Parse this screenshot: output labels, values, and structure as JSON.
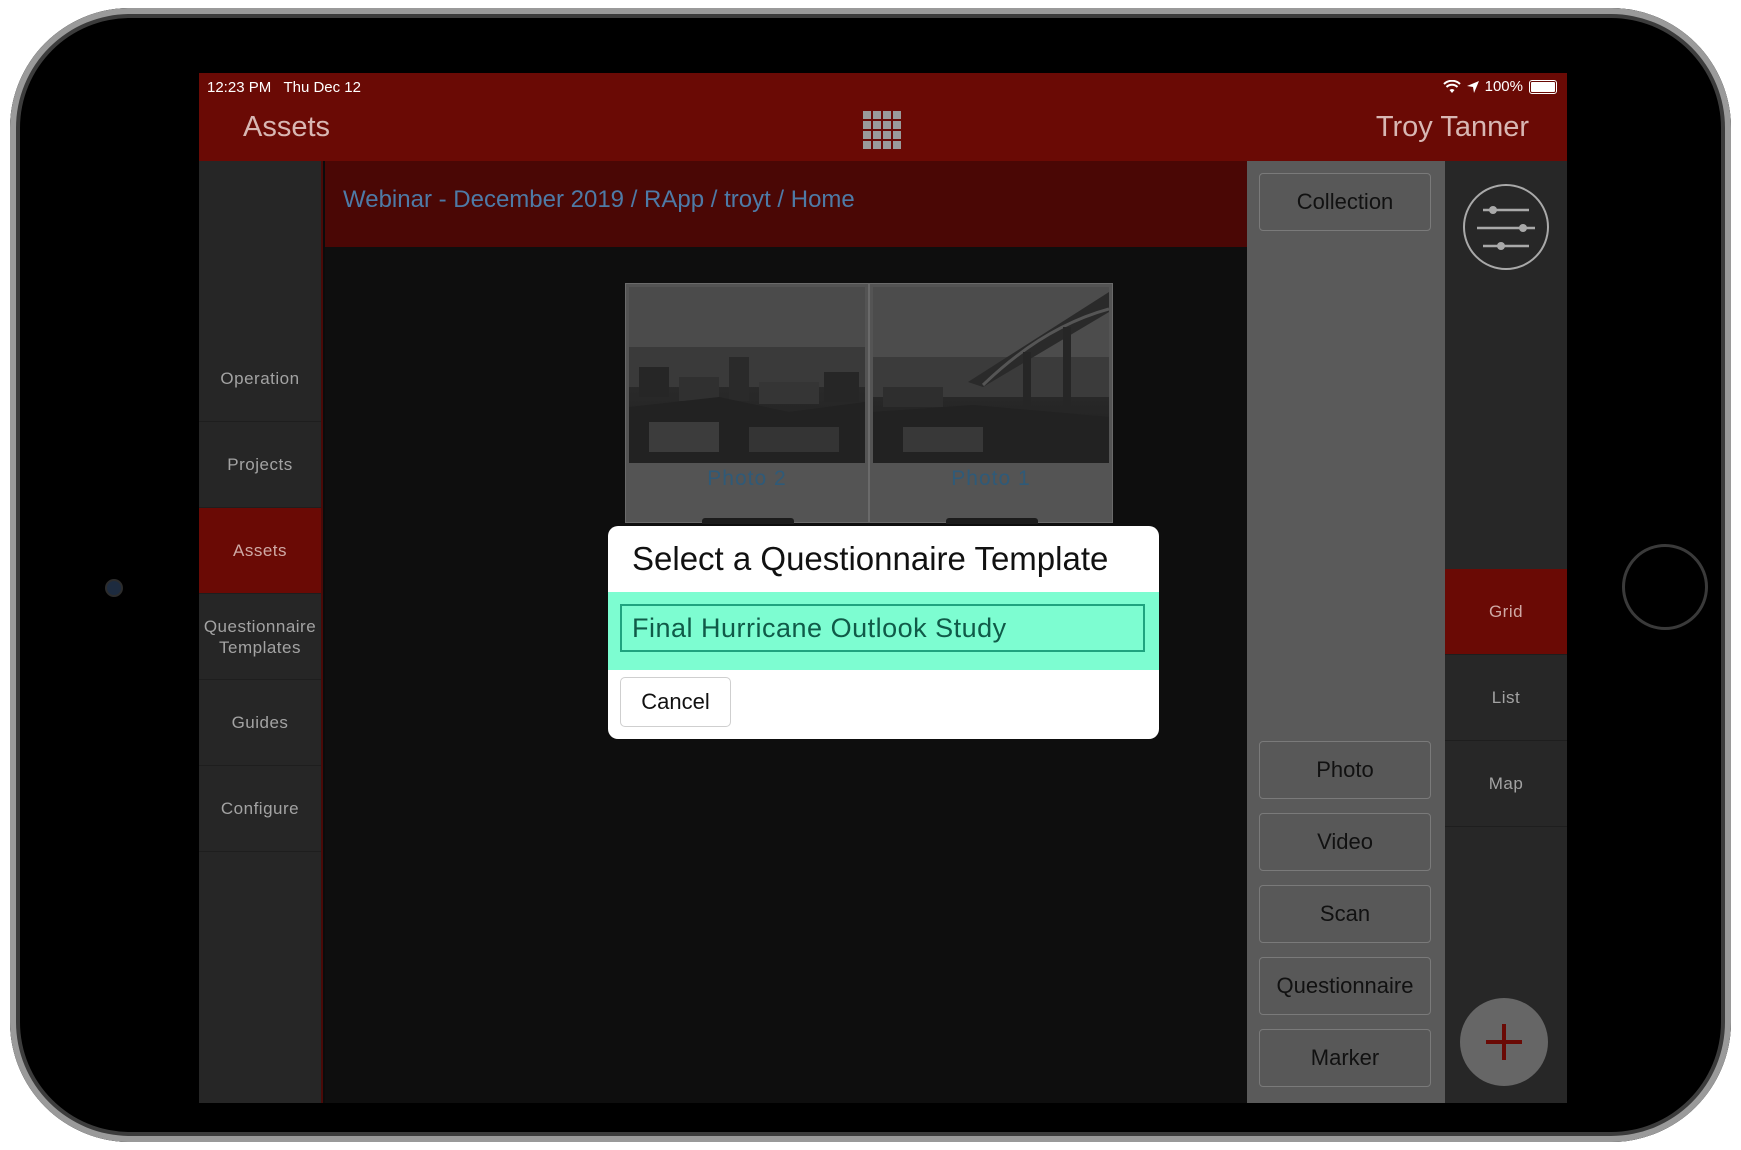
{
  "status_bar": {
    "time": "12:23 PM",
    "date": "Thu Dec 12",
    "battery": "100%"
  },
  "header": {
    "title": "Assets",
    "user": "Troy Tanner"
  },
  "sidebar": {
    "items": [
      {
        "label": "Operation"
      },
      {
        "label": "Projects"
      },
      {
        "label": "Assets",
        "active": true
      },
      {
        "label": "Questionnaire Templates"
      },
      {
        "label": "Guides"
      },
      {
        "label": "Configure"
      }
    ]
  },
  "breadcrumb": "Webinar - December 2019 / RApp / troyt / Home",
  "assets": [
    {
      "label": "Photo 2"
    },
    {
      "label": "Photo 1"
    }
  ],
  "right_panel": {
    "collection": "Collection",
    "buttons": [
      "Photo",
      "Video",
      "Scan",
      "Questionnaire",
      "Marker"
    ]
  },
  "views": {
    "items": [
      {
        "label": "Grid",
        "active": true
      },
      {
        "label": "List"
      },
      {
        "label": "Map"
      }
    ]
  },
  "dialog": {
    "title": "Select a Questionnaire Template",
    "option": "Final Hurricane Outlook Study",
    "cancel": "Cancel"
  },
  "colors": {
    "brand": "#6a0a05",
    "highlight": "#7dfdd1",
    "link": "#4e7aa6"
  },
  "icons": {
    "apps": "grid-icon",
    "filter": "sliders-icon",
    "add": "plus-icon",
    "wifi": "wifi-icon",
    "location": "location-arrow-icon",
    "battery": "battery-icon"
  }
}
